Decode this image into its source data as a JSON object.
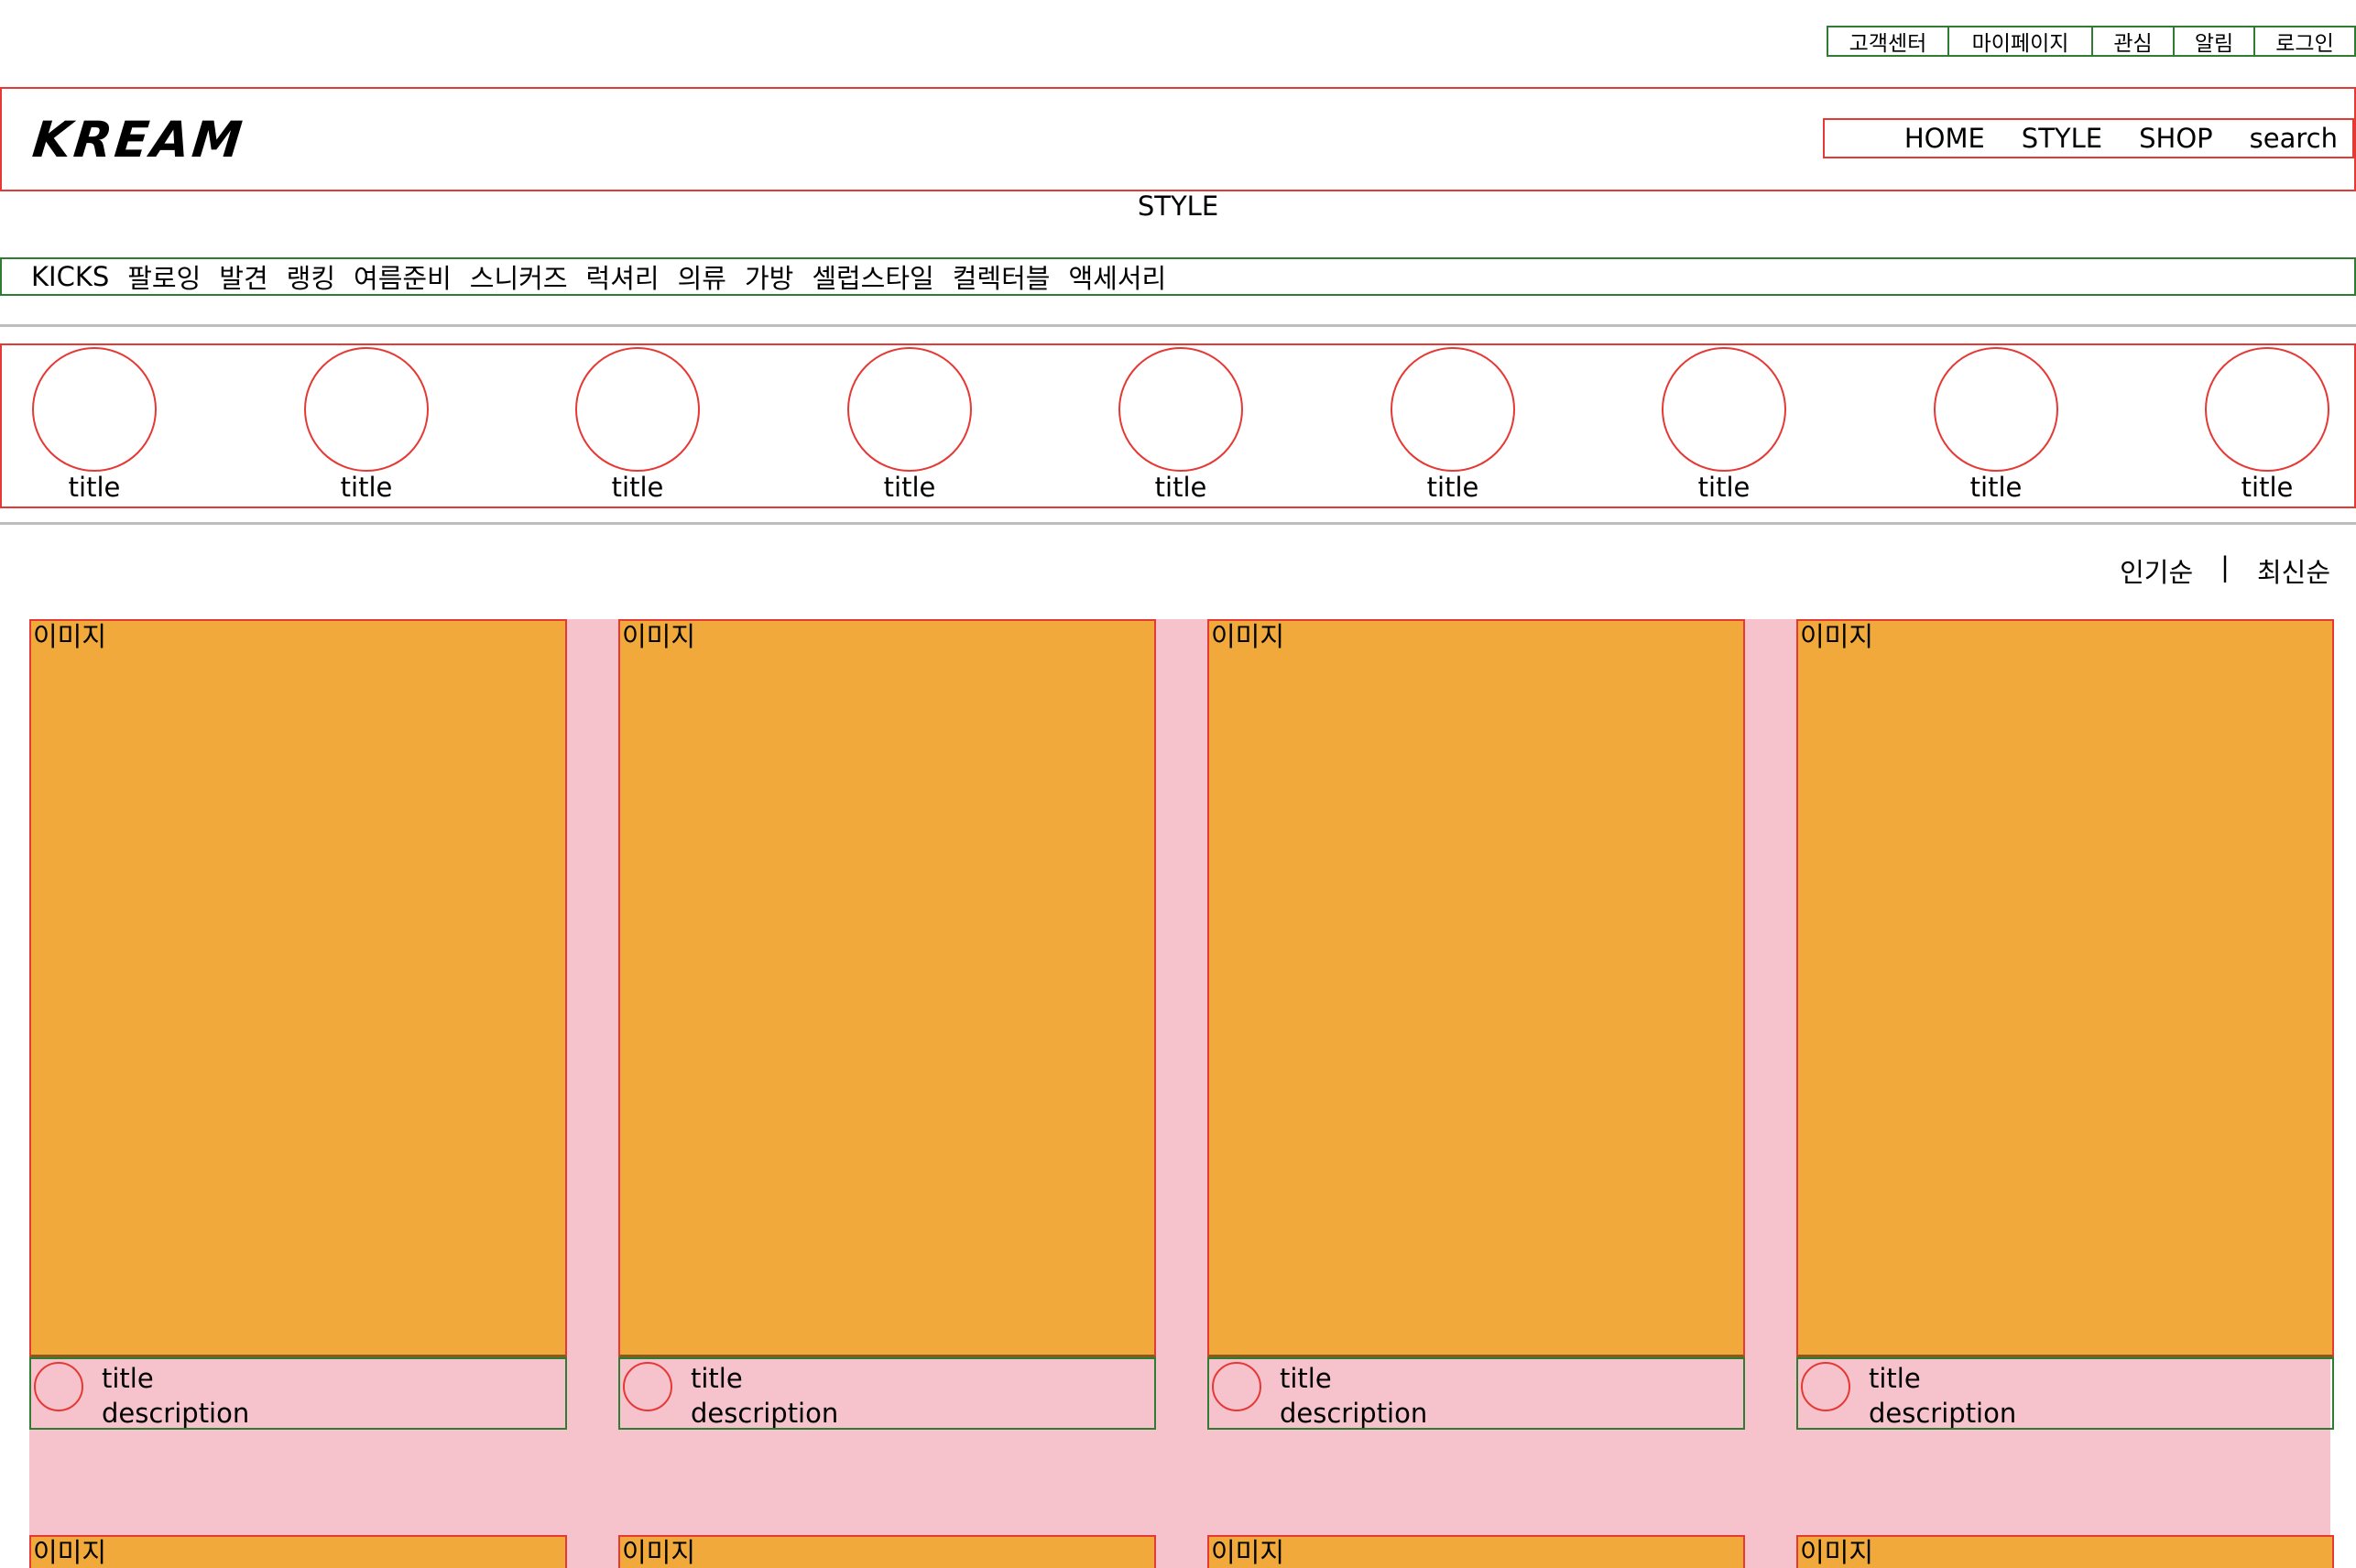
{
  "util_links": [
    "고객센터",
    "마이페이지",
    "관심",
    "알림",
    "로그인"
  ],
  "header": {
    "logo": "KREAM",
    "nav": [
      "HOME",
      "STYLE",
      "SHOP",
      "search"
    ]
  },
  "page_title": "STYLE",
  "categories": [
    "KICKS",
    "팔로잉",
    "발견",
    "랭킹",
    "여름준비",
    "스니커즈",
    "럭셔리",
    "의류",
    "가방",
    "셀럽스타일",
    "컬렉터블",
    "액세서리"
  ],
  "circles": [
    "title",
    "title",
    "title",
    "title",
    "title",
    "title",
    "title",
    "title",
    "title"
  ],
  "sort": {
    "popular": "인기순",
    "divider": "|",
    "latest": "최신순"
  },
  "cards": [
    {
      "image_label": "이미지",
      "title": "title",
      "description": "description"
    },
    {
      "image_label": "이미지",
      "title": "title",
      "description": "description"
    },
    {
      "image_label": "이미지",
      "title": "title",
      "description": "description"
    },
    {
      "image_label": "이미지",
      "title": "title",
      "description": "description"
    }
  ],
  "cards_row2": [
    {
      "image_label": "이미지"
    },
    {
      "image_label": "이미지"
    },
    {
      "image_label": "이미지"
    },
    {
      "image_label": "이미지"
    }
  ]
}
